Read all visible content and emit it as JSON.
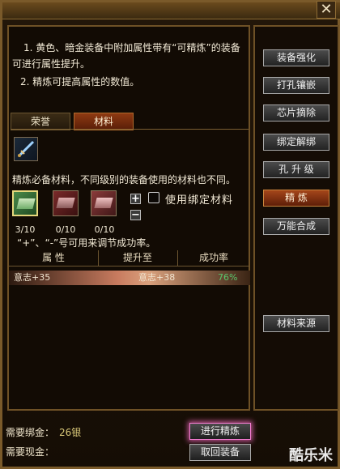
{
  "window": {
    "close_icon": "close-icon"
  },
  "description": {
    "line1": "1. 黄色、暗金装备中附加属性带有“可精炼”的装备",
    "line2": "可进行属性提升。",
    "line3": "2. 精炼可提高属性的数值。"
  },
  "tabs": [
    {
      "label": "荣誉"
    },
    {
      "label": "材料"
    }
  ],
  "materials": {
    "hint": "精炼必备材料，不同级别的装备使用的材料也不同。",
    "counts": [
      "3/10",
      "0/10",
      "0/10"
    ],
    "plus": "+",
    "minus": "−",
    "bind_label": "使用绑定材料",
    "adjust_hint": "“+”、“-”号可用来调节成功率。"
  },
  "table": {
    "headers": [
      "属 性",
      "提升至",
      "成功率"
    ],
    "rows": [
      {
        "attr": "意志+35",
        "upgrade": "意志+38",
        "rate": "76%"
      }
    ]
  },
  "side_menu": [
    {
      "label": "装备强化",
      "active": false
    },
    {
      "label": "打孔镶嵌",
      "active": false
    },
    {
      "label": "芯片摘除",
      "active": false
    },
    {
      "label": "绑定解绑",
      "active": false
    },
    {
      "label": "孔 升 级",
      "active": false
    },
    {
      "label": "精  炼",
      "active": true
    },
    {
      "label": "万能合成",
      "active": false
    },
    {
      "label": "材料来源",
      "active": false
    }
  ],
  "footer": {
    "bind_gold_label": "需要绑金：",
    "bind_gold_value": "26银",
    "cash_label": "需要现金：",
    "cash_value": "",
    "refine_button": "进行精炼",
    "retrieve_button": "取回装备"
  },
  "watermark": "酷乐米",
  "colors": {
    "accent": "#a5461a",
    "rate": "#58c56b",
    "highlight": "#f27bd0"
  }
}
